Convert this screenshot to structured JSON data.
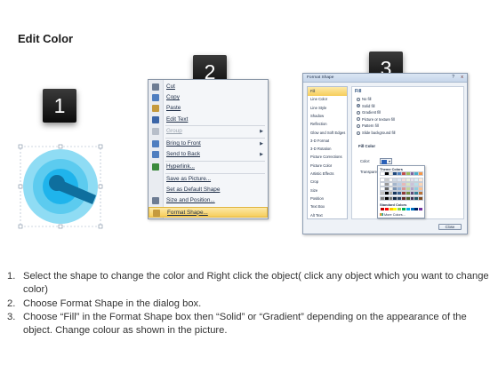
{
  "title": "Edit Color",
  "steps": [
    {
      "number": "1"
    },
    {
      "number": "2"
    },
    {
      "number": "3"
    }
  ],
  "target_shape": {
    "colors": {
      "outer_ring": "#8fdcf4",
      "middle_ring": "#5ccbef",
      "inner_ring": "#1fb4ec",
      "center": "#0f6f9e",
      "selection_handle": "#4aa836"
    }
  },
  "context_menu": {
    "items": [
      {
        "label": "Cut",
        "icon": "scissors-icon",
        "icon_color": "#6d7c93",
        "disabled": false,
        "submenu": false
      },
      {
        "label": "Copy",
        "icon": "copy-icon",
        "icon_color": "#4f7ec0",
        "disabled": false,
        "submenu": false
      },
      {
        "label": "Paste",
        "icon": "paste-icon",
        "icon_color": "#c59a3e",
        "disabled": false,
        "submenu": false
      },
      {
        "label": "Edit Text",
        "icon": "edit-text-icon",
        "icon_color": "#3c66a8",
        "disabled": false,
        "submenu": false
      },
      {
        "label": "Group",
        "icon": "group-icon",
        "icon_color": "#b7bec9",
        "disabled": true,
        "submenu": true
      },
      {
        "label": "Bring to Front",
        "icon": "bring-front-icon",
        "icon_color": "#4f7ec0",
        "disabled": false,
        "submenu": true
      },
      {
        "label": "Send to Back",
        "icon": "send-back-icon",
        "icon_color": "#4f7ec0",
        "disabled": false,
        "submenu": true
      },
      {
        "label": "Hyperlink...",
        "icon": "hyperlink-icon",
        "icon_color": "#3a8a3c",
        "disabled": false,
        "submenu": false
      },
      {
        "label": "Save as Picture...",
        "icon": "",
        "icon_color": "",
        "disabled": false,
        "submenu": false
      },
      {
        "label": "Set as Default Shape",
        "icon": "",
        "icon_color": "",
        "disabled": false,
        "submenu": false
      },
      {
        "label": "Size and Position...",
        "icon": "size-position-icon",
        "icon_color": "#6d7c93",
        "disabled": false,
        "submenu": false
      },
      {
        "label": "Format Shape...",
        "icon": "format-shape-icon",
        "icon_color": "#c59a3e",
        "disabled": false,
        "submenu": false,
        "selected": true
      }
    ]
  },
  "format_dialog": {
    "title": "Format Shape",
    "help_label": "?",
    "close_label": "x",
    "categories": [
      "Fill",
      "Line Color",
      "Line Style",
      "Shadow",
      "Reflection",
      "Glow and Soft Edges",
      "3-D Format",
      "3-D Rotation",
      "Picture Corrections",
      "Picture Color",
      "Artistic Effects",
      "Crop",
      "Size",
      "Position",
      "Text Box",
      "Alt Text"
    ],
    "selected_category": "Fill",
    "section_heading": "Fill",
    "fill_options": [
      {
        "label": "No fill",
        "selected": false
      },
      {
        "label": "Solid fill",
        "selected": true
      },
      {
        "label": "Gradient fill",
        "selected": false
      },
      {
        "label": "Picture or texture fill",
        "selected": false
      },
      {
        "label": "Pattern fill",
        "selected": false
      },
      {
        "label": "Slide background fill",
        "selected": false
      }
    ],
    "fill_color_heading": "Fill Color",
    "color_label": "Color:",
    "transparency_label": "Transpare",
    "palette": {
      "theme_heading": "Theme Colors",
      "standard_heading": "Standard Colors",
      "more_colors": "More Colors...",
      "theme_colors": [
        "#ffffff",
        "#000000",
        "#eeece1",
        "#1f497d",
        "#4f81bd",
        "#c0504d",
        "#9bbb59",
        "#8064a2",
        "#4bacc6",
        "#f79646"
      ],
      "standard_colors": [
        "#c00000",
        "#ff0000",
        "#ffc000",
        "#ffff00",
        "#92d050",
        "#00b050",
        "#00b0f0",
        "#0070c0",
        "#002060",
        "#7030a0"
      ]
    },
    "close_button": "Close"
  },
  "instructions": [
    {
      "num": "1.",
      "text": "Select the shape to change the color and Right click the object( click any object which you want to change color)"
    },
    {
      "num": "2.",
      "text": "Choose Format Shape in the dialog box."
    },
    {
      "num": "3.",
      "text": "Choose “Fill” in the Format Shape box then “Solid” or “Gradient” depending on the appearance of the object. Change colour as shown in the picture."
    }
  ]
}
